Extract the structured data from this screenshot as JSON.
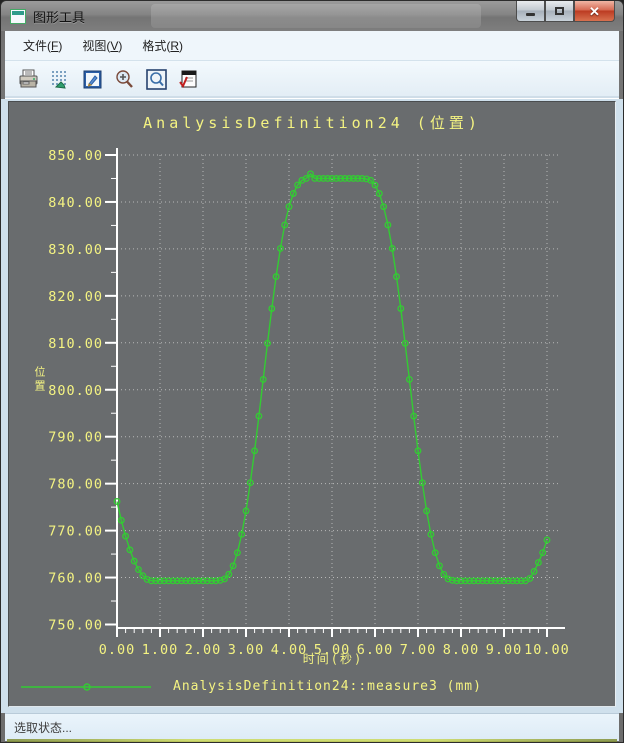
{
  "window": {
    "title": "图形工具"
  },
  "menu": {
    "items": [
      {
        "pre": "文件(",
        "key": "F",
        "post": ")"
      },
      {
        "pre": "视图(",
        "key": "V",
        "post": ")"
      },
      {
        "pre": "格式(",
        "key": "R",
        "post": ")"
      }
    ]
  },
  "toolbar": {
    "buttons": [
      {
        "icon": "print-icon"
      },
      {
        "icon": "point-display-icon"
      },
      {
        "icon": "edit-graph-icon"
      },
      {
        "icon": "zoom-in-icon"
      },
      {
        "icon": "zoom-refit-icon"
      },
      {
        "icon": "graph-options-icon"
      }
    ]
  },
  "chart": {
    "title": "AnalysisDefinition24 (位置)",
    "x_axis_label": "时间(秒)",
    "y_axis_label": "位置",
    "legend": "AnalysisDefinition24::measure3 (mm)"
  },
  "chart_data": {
    "type": "line",
    "title": "AnalysisDefinition24 (位置)",
    "xlabel": "时间(秒)",
    "ylabel": "位置",
    "xlim": [
      0,
      10
    ],
    "ylim": [
      750,
      850
    ],
    "x_ticks": [
      0,
      1,
      2,
      3,
      4,
      5,
      6,
      7,
      8,
      9,
      10
    ],
    "y_ticks": [
      750,
      760,
      770,
      780,
      790,
      800,
      810,
      820,
      830,
      840,
      850
    ],
    "x_minor_step": 0.2,
    "y_minor_step": 5,
    "grid": true,
    "legend_position": "bottom",
    "series": [
      {
        "name": "AnalysisDefinition24::measure3 (mm)",
        "color": "#33cc33",
        "marker": "circle",
        "x": [
          0.0,
          0.1,
          0.2,
          0.3,
          0.4,
          0.5,
          0.6,
          0.7,
          0.8,
          0.9,
          1.0,
          1.1,
          1.2,
          1.3,
          1.4,
          1.5,
          1.6,
          1.7,
          1.8,
          1.9,
          2.0,
          2.1,
          2.2,
          2.3,
          2.4,
          2.5,
          2.6,
          2.7,
          2.8,
          2.9,
          3.0,
          3.1,
          3.2,
          3.3,
          3.4,
          3.5,
          3.6,
          3.7,
          3.8,
          3.9,
          4.0,
          4.1,
          4.2,
          4.3,
          4.4,
          4.5,
          4.6,
          4.7,
          4.8,
          4.9,
          5.0,
          5.1,
          5.2,
          5.3,
          5.4,
          5.5,
          5.6,
          5.7,
          5.8,
          5.9,
          6.0,
          6.1,
          6.2,
          6.3,
          6.4,
          6.5,
          6.6,
          6.7,
          6.8,
          6.9,
          7.0,
          7.1,
          7.2,
          7.3,
          7.4,
          7.5,
          7.6,
          7.7,
          7.8,
          7.9,
          8.0,
          8.1,
          8.2,
          8.3,
          8.4,
          8.5,
          8.6,
          8.7,
          8.8,
          8.9,
          9.0,
          9.1,
          9.2,
          9.3,
          9.4,
          9.5,
          9.6,
          9.7,
          9.8,
          9.9,
          10.0
        ],
        "y": [
          776.2,
          772.2,
          768.8,
          765.9,
          763.5,
          761.7,
          760.4,
          759.6,
          759.3,
          759.3,
          759.3,
          759.3,
          759.3,
          759.3,
          759.3,
          759.3,
          759.3,
          759.3,
          759.3,
          759.3,
          759.3,
          759.3,
          759.3,
          759.3,
          759.4,
          759.7,
          760.7,
          762.5,
          765.3,
          769.2,
          774.2,
          780.2,
          787.0,
          794.4,
          802.2,
          809.9,
          817.3,
          824.1,
          830.1,
          835.1,
          839.0,
          841.8,
          843.6,
          844.6,
          845.0,
          846.0,
          845.0,
          845.0,
          845.0,
          845.0,
          845.0,
          845.0,
          845.0,
          845.0,
          845.0,
          845.0,
          845.0,
          845.0,
          844.9,
          844.6,
          843.6,
          841.8,
          839.0,
          835.1,
          830.1,
          824.1,
          817.3,
          809.9,
          802.2,
          794.4,
          787.0,
          780.2,
          774.2,
          769.2,
          765.3,
          762.5,
          760.7,
          759.7,
          759.4,
          759.3,
          759.3,
          759.3,
          759.3,
          759.3,
          759.3,
          759.3,
          759.3,
          759.3,
          759.3,
          759.3,
          759.3,
          759.3,
          759.3,
          759.3,
          759.3,
          759.3,
          759.8,
          761.3,
          763.2,
          765.3,
          768.0
        ]
      }
    ]
  },
  "status_bar": {
    "text": "选取状态..."
  },
  "colors": {
    "curve": "#33cc33",
    "plot_background": "#696c6e",
    "axis": "#ffffff",
    "labels": "#f4f382",
    "grid": "#b8b8b8"
  }
}
